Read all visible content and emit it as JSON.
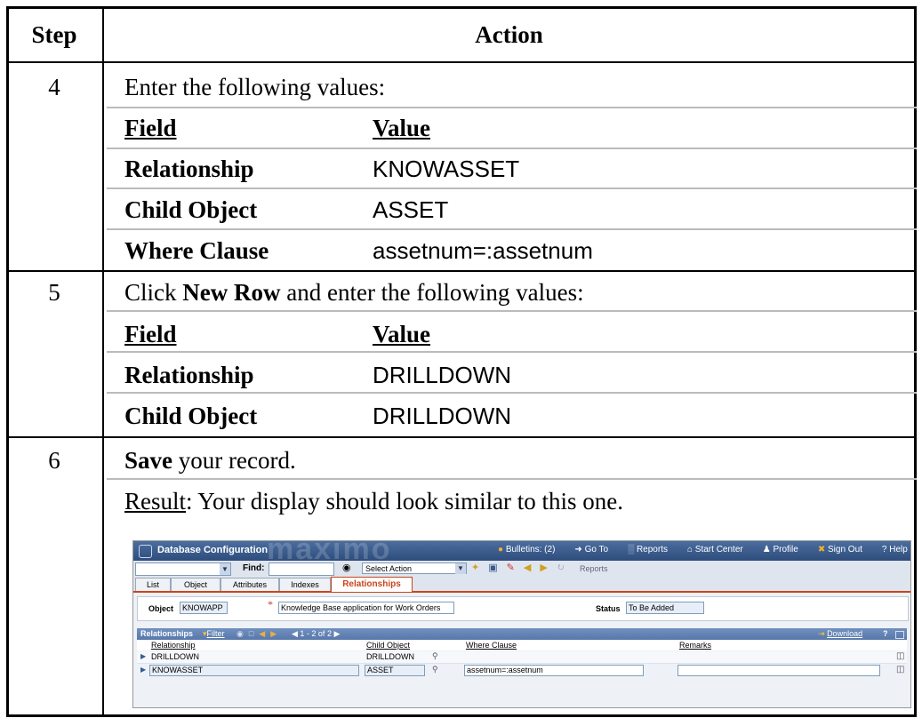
{
  "header": {
    "step": "Step",
    "action": "Action"
  },
  "steps": [
    {
      "number": "4",
      "intro": "Enter the following values:",
      "field_header": "Field",
      "value_header": "Value",
      "rows": [
        {
          "field": "Relationship",
          "value": "KNOWASSET"
        },
        {
          "field": "Child Object",
          "value": "ASSET"
        },
        {
          "field": "Where Clause",
          "value": "assetnum=:assetnum"
        }
      ]
    },
    {
      "number": "5",
      "intro_prefix": "Click ",
      "intro_bold": "New Row",
      "intro_suffix": " and enter the following values:",
      "field_header": "Field",
      "value_header": "Value",
      "rows": [
        {
          "field": "Relationship",
          "value": "DRILLDOWN"
        },
        {
          "field": "Child Object",
          "value": "DRILLDOWN"
        }
      ]
    },
    {
      "number": "6",
      "save_bold": "Save",
      "save_rest": " your record.",
      "result_label": "Result",
      "result_rest": ": Your display should look similar to this one."
    }
  ],
  "screenshot": {
    "app_title": "Database Configuration",
    "brand": "maximo",
    "nav": {
      "bulletins": "Bulletins: (2)",
      "goto": "Go To",
      "reports": "Reports",
      "start_center": "Start Center",
      "profile": "Profile",
      "sign_out": "Sign Out",
      "help": "Help"
    },
    "toolbar": {
      "find_label": "Find:",
      "select_action": "Select Action",
      "reports_label": "Reports"
    },
    "tabs": [
      "List",
      "Object",
      "Attributes",
      "Indexes",
      "Relationships"
    ],
    "object_label": "Object",
    "object_value": "KNOWAPP",
    "description_value": "Knowledge Base application for Work Orders",
    "status_label": "Status",
    "status_value": "To Be Added",
    "section_title": "Relationships",
    "filter_label": "Filter",
    "paging": "1 - 2 of 2",
    "download_label": "Download",
    "columns": [
      "Relationship",
      "Child Object",
      "Where Clause",
      "Remarks"
    ],
    "rows": [
      {
        "relationship": "DRILLDOWN",
        "child_object": "DRILLDOWN",
        "where_clause": "",
        "remarks": ""
      },
      {
        "relationship": "KNOWASSET",
        "child_object": "ASSET",
        "where_clause": "assetnum=:assetnum",
        "remarks": ""
      }
    ],
    "colors": {
      "title_bar": "#3a5a8c",
      "section_bar": "#5b7fb5",
      "active_tab": "#c8451c"
    }
  }
}
